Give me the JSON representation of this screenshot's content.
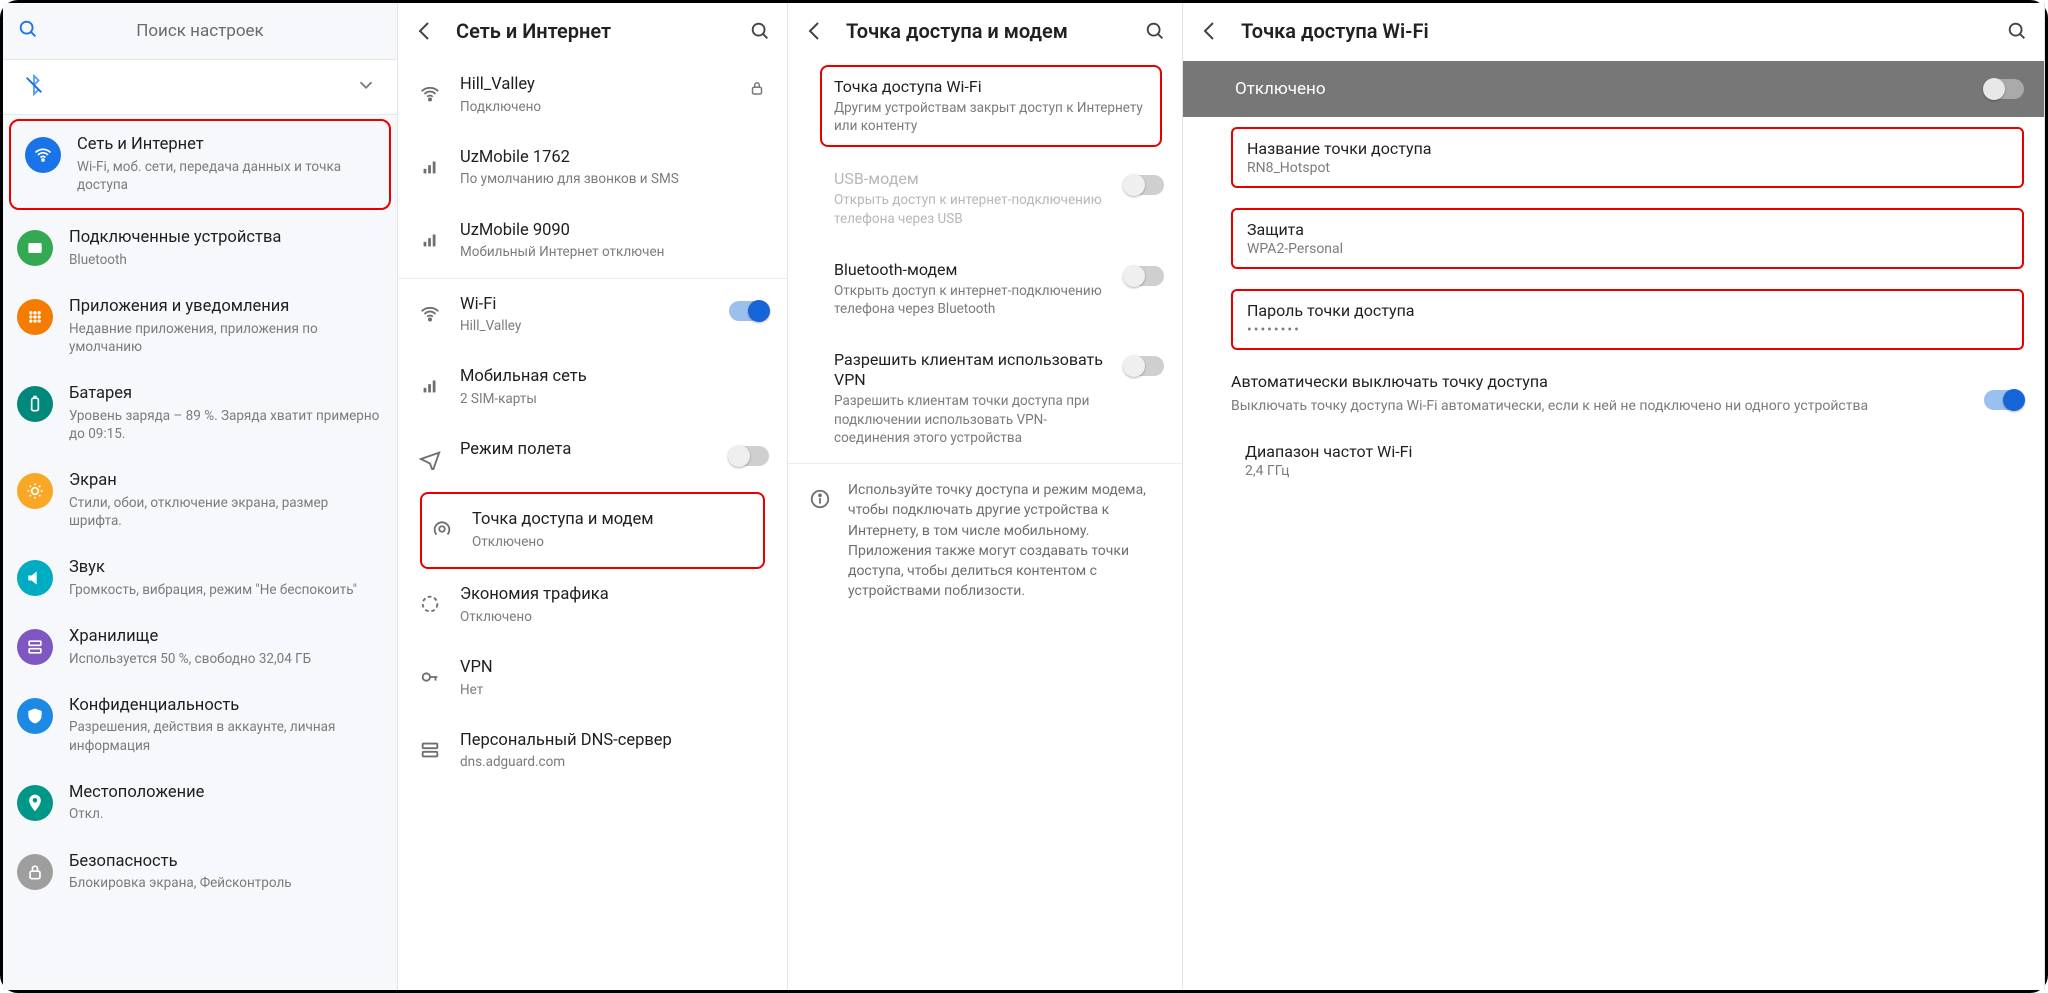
{
  "panel1": {
    "search_placeholder": "Поиск настроек",
    "items": [
      {
        "title": "Сеть и Интернет",
        "sub": "Wi-Fi, моб. сети, передача данных и точка доступа"
      },
      {
        "title": "Подключенные устройства",
        "sub": "Bluetooth"
      },
      {
        "title": "Приложения и уведомления",
        "sub": "Недавние приложения, приложения по умолчанию"
      },
      {
        "title": "Батарея",
        "sub": "Уровень заряда – 89 %. Заряда хватит примерно до 09:15."
      },
      {
        "title": "Экран",
        "sub": "Стили, обои, отключение экрана, размер шрифта."
      },
      {
        "title": "Звук",
        "sub": "Громкость, вибрация, режим \"Не беспокоить\""
      },
      {
        "title": "Хранилище",
        "sub": "Используется 50 %, свободно 32,04 ГБ"
      },
      {
        "title": "Конфиденциальность",
        "sub": "Разрешения, действия в аккаунте, личная информация"
      },
      {
        "title": "Местоположение",
        "sub": "Откл."
      },
      {
        "title": "Безопасность",
        "sub": "Блокировка экрана, Фейсконтроль"
      }
    ]
  },
  "panel2": {
    "title": "Сеть и Интернет",
    "items": [
      {
        "title": "Hill_Valley",
        "sub": "Подключено"
      },
      {
        "title": "UzMobile 1762",
        "sub": "По умолчанию для звонков и SMS"
      },
      {
        "title": "UzMobile 9090",
        "sub": "Мобильный Интернет отключен"
      },
      {
        "title": "Wi-Fi",
        "sub": "Hill_Valley"
      },
      {
        "title": "Мобильная сеть",
        "sub": "2 SIM-карты"
      },
      {
        "title": "Режим полета",
        "sub": ""
      },
      {
        "title": "Точка доступа и модем",
        "sub": "Отключено"
      },
      {
        "title": "Экономия трафика",
        "sub": "Отключено"
      },
      {
        "title": "VPN",
        "sub": "Нет"
      },
      {
        "title": "Персональный DNS-сервер",
        "sub": "dns.adguard.com"
      }
    ]
  },
  "panel3": {
    "title": "Точка доступа и модем",
    "items": [
      {
        "title": "Точка доступа Wi-Fi",
        "sub": "Другим устройствам закрыт доступ к Интернету или контенту"
      },
      {
        "title": "USB-модем",
        "sub": "Открыть доступ к интернет-подключению телефона через USB"
      },
      {
        "title": "Bluetooth-модем",
        "sub": "Открыть доступ к интернет-подключению телефона через Bluetooth"
      },
      {
        "title": "Разрешить клиентам использовать VPN",
        "sub": "Разрешить клиентам точки доступа при подключении использовать VPN-соединения этого устройства"
      }
    ],
    "info": "Используйте точку доступа и режим модема, чтобы подключать другие устройства к Интернету, в том числе мобильному. Приложения также могут создавать точки доступа, чтобы делиться контентом с устройствами поблизости."
  },
  "panel4": {
    "title": "Точка доступа Wi-Fi",
    "status": "Отключено",
    "entries": [
      {
        "title": "Название точки доступа",
        "sub": "RN8_Hotspot"
      },
      {
        "title": "Защита",
        "sub": "WPA2-Personal"
      },
      {
        "title": "Пароль точки доступа",
        "sub": "••••••••"
      }
    ],
    "auto": {
      "title": "Автоматически выключать точку доступа",
      "sub": "Выключать точку доступа Wi-Fi автоматически, если к ней не подключено ни одного устройства"
    },
    "band": {
      "title": "Диапазон частот Wi-Fi",
      "sub": "2,4 ГГц"
    }
  }
}
